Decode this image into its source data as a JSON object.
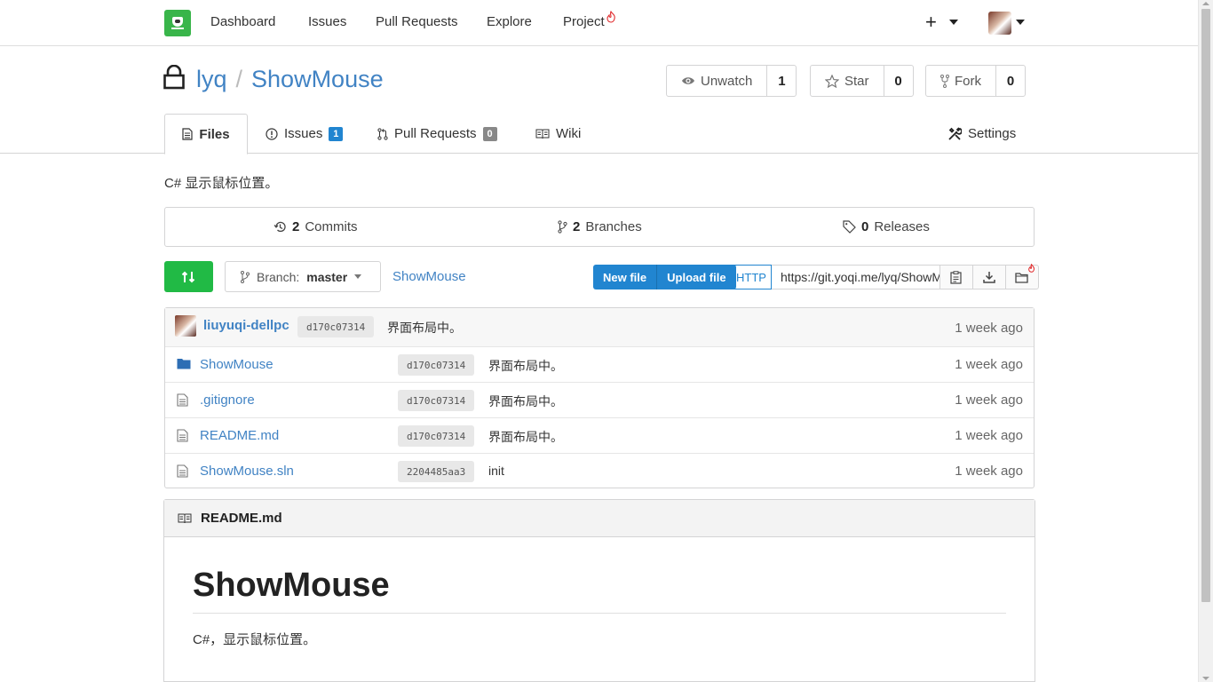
{
  "nav": {
    "items": [
      "Dashboard",
      "Issues",
      "Pull Requests",
      "Explore",
      "Project"
    ],
    "plus": "+"
  },
  "repo": {
    "owner": "lyq",
    "separator": "/",
    "name": "ShowMouse",
    "description": "C# 显示鼠标位置。"
  },
  "actions": {
    "unwatch_label": "Unwatch",
    "unwatch_count": "1",
    "star_label": "Star",
    "star_count": "0",
    "fork_label": "Fork",
    "fork_count": "0"
  },
  "tabs": {
    "files": "Files",
    "issues": "Issues",
    "issues_count": "1",
    "pulls": "Pull Requests",
    "pulls_count": "0",
    "wiki": "Wiki",
    "settings": "Settings"
  },
  "stats": {
    "commits_count": "2",
    "commits_label": "Commits",
    "branches_count": "2",
    "branches_label": "Branches",
    "releases_count": "0",
    "releases_label": "Releases"
  },
  "toolbar": {
    "branch_prefix": "Branch:",
    "branch_name": "master",
    "path": "ShowMouse",
    "new_file": "New file",
    "upload_file": "Upload file",
    "protocol": "HTTP",
    "clone_url": "https://git.yoqi.me/lyq/ShowMouse.git"
  },
  "latest_commit": {
    "author": "liuyuqi-dellpc",
    "sha": "d170c07314",
    "message": "界面布局中。",
    "time": "1 week ago"
  },
  "files": [
    {
      "name": "ShowMouse",
      "type": "folder",
      "sha": "d170c07314",
      "message": "界面布局中。",
      "time": "1 week ago"
    },
    {
      "name": ".gitignore",
      "type": "file",
      "sha": "d170c07314",
      "message": "界面布局中。",
      "time": "1 week ago"
    },
    {
      "name": "README.md",
      "type": "file",
      "sha": "d170c07314",
      "message": "界面布局中。",
      "time": "1 week ago"
    },
    {
      "name": "ShowMouse.sln",
      "type": "file",
      "sha": "2204485aa3",
      "message": "init",
      "time": "1 week ago"
    }
  ],
  "readme": {
    "filename": "README.md",
    "heading": "ShowMouse",
    "body": "C#，显示鼠标位置。"
  },
  "colors": {
    "link": "#4183c4",
    "green": "#21ba45",
    "blue": "#2185d0",
    "logo": "#39b54a"
  }
}
